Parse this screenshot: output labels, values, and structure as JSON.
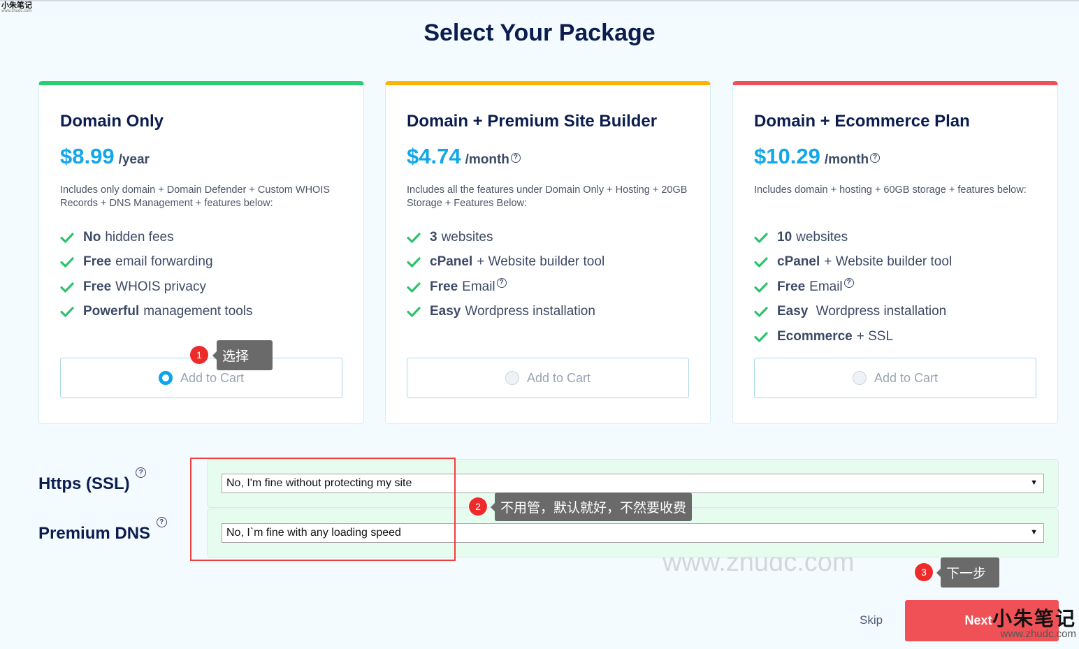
{
  "watermark": {
    "chinese": "小朱笔记",
    "url": "www.zhudc.com"
  },
  "page_title": "Select Your Package",
  "packages": [
    {
      "title": "Domain Only",
      "price": "$8.99",
      "unit": "/year",
      "has_help": false,
      "accent_color": "#2bcd72",
      "description": "Includes only domain + Domain Defender + Custom WHOIS Records + DNS Management + features below:",
      "features": [
        {
          "bold": "No",
          "text": "hidden fees",
          "help": false
        },
        {
          "bold": "Free",
          "text": "email forwarding",
          "help": false
        },
        {
          "bold": "Free",
          "text": "WHOIS privacy",
          "help": false
        },
        {
          "bold": "Powerful",
          "text": "management tools",
          "help": false
        }
      ],
      "cart_label": "Add to Cart",
      "selected": true
    },
    {
      "title": "Domain + Premium Site Builder",
      "price": "$4.74",
      "unit": "/month",
      "has_help": true,
      "accent_color": "#ffb300",
      "description": "Includes all the features under Domain Only + Hosting + 20GB Storage + Features Below:",
      "features": [
        {
          "bold": "3",
          "text": "websites",
          "help": false
        },
        {
          "bold": "cPanel",
          "text": "+ Website builder tool",
          "help": false
        },
        {
          "bold": "Free",
          "text": "Email",
          "help": true
        },
        {
          "bold": "Easy",
          "text": "Wordpress installation",
          "help": false
        }
      ],
      "cart_label": "Add to Cart",
      "selected": false
    },
    {
      "title": "Domain + Ecommerce Plan",
      "price": "$10.29",
      "unit": "/month",
      "has_help": true,
      "accent_color": "#ef5054",
      "description": "Includes domain + hosting + 60GB storage + features below:",
      "features": [
        {
          "bold": "10",
          "text": "websites",
          "help": false
        },
        {
          "bold": "cPanel",
          "text": "+ Website builder tool",
          "help": false
        },
        {
          "bold": "Free",
          "text": "Email",
          "help": true
        },
        {
          "bold": "Easy",
          "text": " Wordpress installation",
          "help": false
        },
        {
          "bold": "Ecommerce",
          "text": "+ SSL",
          "help": false
        }
      ],
      "cart_label": "Add to Cart",
      "selected": false
    }
  ],
  "addons": {
    "ssl": {
      "label": "Https (SSL)",
      "selected": "No, I'm fine without protecting my site"
    },
    "dns": {
      "label": "Premium DNS",
      "selected": "No, I`m fine with any loading speed"
    }
  },
  "annotations": [
    {
      "number": "1",
      "text": "选择"
    },
    {
      "number": "2",
      "text": "不用管，默认就好，不然要收费"
    },
    {
      "number": "3",
      "text": "下一步"
    }
  ],
  "footer": {
    "skip_label": "Skip",
    "next_label": "Next"
  },
  "help_glyph": "?",
  "dropdown_arrow": "▼"
}
